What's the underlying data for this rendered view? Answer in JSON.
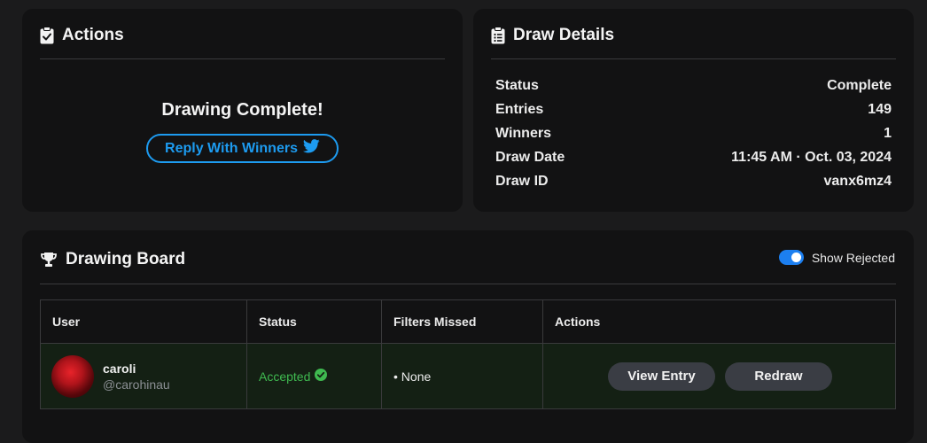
{
  "actions_card": {
    "title": "Actions",
    "status_message": "Drawing Complete!",
    "reply_button_label": "Reply With Winners"
  },
  "details_card": {
    "title": "Draw Details",
    "rows": [
      {
        "label": "Status",
        "value": "Complete"
      },
      {
        "label": "Entries",
        "value": "149"
      },
      {
        "label": "Winners",
        "value": "1"
      },
      {
        "label": "Draw Date",
        "value": "11:45 AM · Oct. 03, 2024"
      },
      {
        "label": "Draw ID",
        "value": "vanx6mz4"
      }
    ]
  },
  "board_card": {
    "title": "Drawing Board",
    "toggle_label": "Show Rejected",
    "toggle_on": true,
    "columns": [
      "User",
      "Status",
      "Filters Missed",
      "Actions"
    ],
    "rows": [
      {
        "name": "caroli",
        "handle": "@carohinau",
        "status": "Accepted",
        "filters_missed": "• None",
        "view_label": "View Entry",
        "redraw_label": "Redraw"
      }
    ]
  },
  "colors": {
    "accent_blue": "#1d9bf0",
    "toggle_blue": "#1c7ff0",
    "accepted_green": "#3fb950",
    "row_highlight": "#142014",
    "card_bg": "#121213",
    "page_bg": "#1b1b1c"
  },
  "icons": {
    "actions": "clipboard-check-icon",
    "details": "clipboard-list-icon",
    "board": "trophy-icon",
    "reply": "twitter-bird-icon",
    "accepted": "check-circle-icon"
  }
}
